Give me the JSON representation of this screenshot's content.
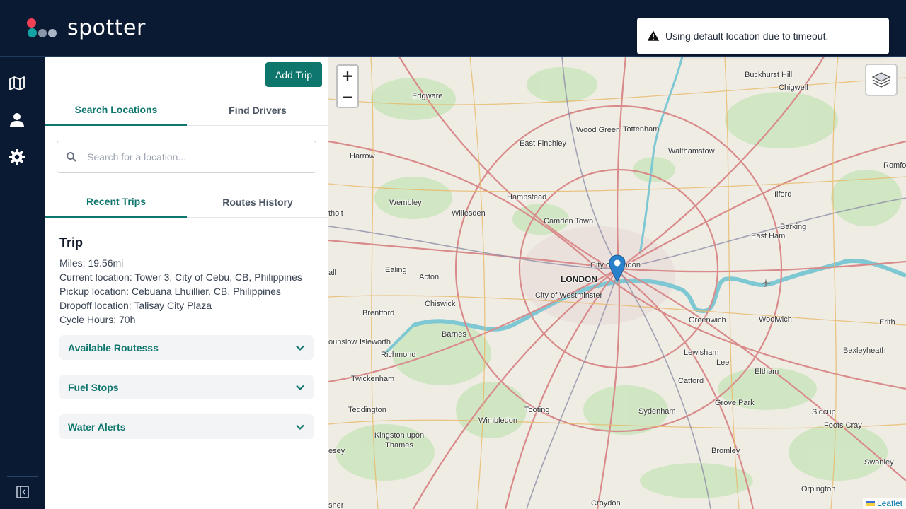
{
  "header": {
    "brand": "spotter",
    "logo_colors": [
      "#ef4056",
      "#14a3a3",
      "#6b7a8f",
      "#9aa6b8"
    ]
  },
  "toast": {
    "icon": "warning-icon",
    "message": "Using default location due to timeout."
  },
  "rail": {
    "items": [
      {
        "icon": "map-icon"
      },
      {
        "icon": "user-icon"
      },
      {
        "icon": "gear-icon"
      }
    ],
    "collapse_icon": "collapse-sidebar-icon"
  },
  "panel": {
    "add_trip_label": "Add Trip",
    "top_tabs": [
      {
        "label": "Search Locations",
        "active": true
      },
      {
        "label": "Find Drivers",
        "active": false
      }
    ],
    "search": {
      "placeholder": "Search for a location...",
      "value": ""
    },
    "sub_tabs": [
      {
        "label": "Recent Trips",
        "active": true
      },
      {
        "label": "Routes History",
        "active": false
      }
    ],
    "trip": {
      "title": "Trip",
      "miles": "Miles: 19.56mi",
      "current_location": "Current location: Tower 3, City of Cebu, CB, Philippines",
      "pickup_location": "Pickup location: Cebuana Lhuillier, CB, Philippines",
      "dropoff_location": "Dropoff location: Talisay City Plaza",
      "cycle_hours": "Cycle Hours: 70h"
    },
    "accordions": [
      {
        "label": "Available Routesss"
      },
      {
        "label": "Fuel Stops"
      },
      {
        "label": "Water Alerts"
      }
    ]
  },
  "map": {
    "zoom_in": "+",
    "zoom_out": "−",
    "attribution": "Leaflet",
    "accent": "#0f766e",
    "marker_color": "#2a81cb",
    "labels": {
      "buckhurst_hill": "Buckhurst Hill",
      "chigwell": "Chigwell",
      "edgware": "Edgware",
      "wood_green": "Wood Green",
      "tottenham": "Tottenham",
      "east_finchley": "East Finchley",
      "harrow": "Harrow",
      "walthamstow": "Walthamstow",
      "romford": "Romfor",
      "hampstead": "Hampstead",
      "ilford": "Ilford",
      "wembley": "Wembley",
      "willesden": "Willesden",
      "northolt": "tholt",
      "camden_town": "Camden Town",
      "barking": "Barking",
      "east_ham": "East Ham",
      "city_of_london": "City of London",
      "london": "LONDON",
      "ealing": "Ealing",
      "acton": "Acton",
      "city_of_westminster": "City of Westminster",
      "hall": "all",
      "chiswick": "Chiswick",
      "brentford": "Brentford",
      "greenwich": "Greenwich",
      "woolwich": "Woolwich",
      "erith": "Erith",
      "barnes": "Barnes",
      "hounslow": "ounslow",
      "isleworth": "Isleworth",
      "richmond": "Richmond",
      "lewisham": "Lewisham",
      "bexleyheath": "Bexleyheath",
      "lee": "Lee",
      "eltham": "Eltham",
      "twickenham": "Twickenham",
      "catford": "Catford",
      "teddington": "Teddington",
      "tooting": "Tooting",
      "grove_park": "Grove Park",
      "sidcup": "Sidcup",
      "sydenham": "Sydenham",
      "foots_cray": "Foots Cray",
      "wimbledon": "Wimbledon",
      "kingston": "Kingston upon Thames",
      "bromley": "Bromley",
      "esey": "esey",
      "swanley": "Swanley",
      "orpington": "Orpington",
      "croydon": "Croydon",
      "sher": "sher"
    }
  }
}
